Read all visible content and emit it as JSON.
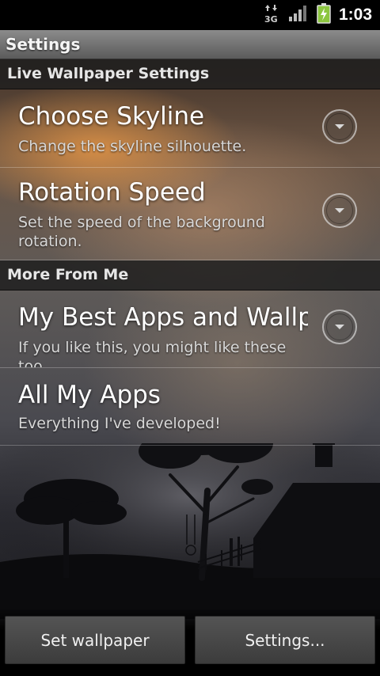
{
  "status_bar": {
    "network": "3G",
    "time": "1:03",
    "icons": [
      "data-transfer-3g-icon",
      "signal-strength-icon",
      "battery-charging-icon"
    ]
  },
  "title_bar": {
    "title": "Settings"
  },
  "sections": [
    {
      "header": "Live Wallpaper Settings",
      "items": [
        {
          "title": "Choose Skyline",
          "summary": "Change the skyline silhouette.",
          "has_dropdown": true
        },
        {
          "title": "Rotation Speed",
          "summary": "Set the speed of the background rotation.",
          "has_dropdown": true
        }
      ]
    },
    {
      "header": "More From Me",
      "items": [
        {
          "title": "My Best Apps and Wallpapers",
          "summary": "If you like this, you might like these too.",
          "has_dropdown": true
        },
        {
          "title": "All My Apps",
          "summary": "Everything I've developed!",
          "has_dropdown": false
        }
      ]
    }
  ],
  "buttons": {
    "set_wallpaper": "Set wallpaper",
    "settings": "Settings..."
  },
  "colors": {
    "status_bar_bg": "#000000",
    "title_bar_bg": "#7a7a7a",
    "section_header_bg": "#1e1e1e",
    "battery_green": "#8cc63f"
  }
}
